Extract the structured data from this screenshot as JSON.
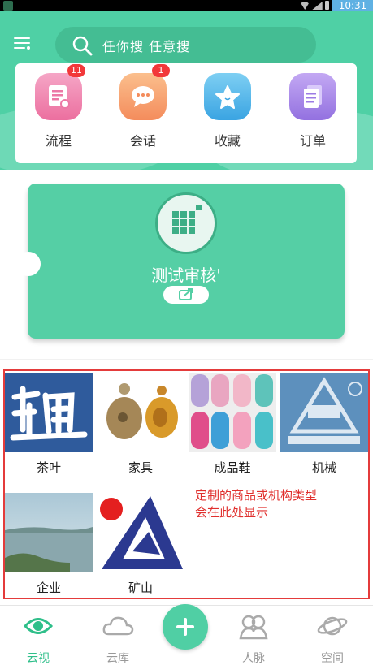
{
  "status_bar": {
    "time": "10:31"
  },
  "search": {
    "placeholder": "任你搜  任意搜"
  },
  "quick_actions": [
    {
      "label": "流程",
      "badge": "11",
      "icon": "document-icon",
      "color": "#f08bb2"
    },
    {
      "label": "会话",
      "badge": "1",
      "icon": "chat-icon",
      "color": "#f7a577"
    },
    {
      "label": "收藏",
      "badge": "",
      "icon": "star-icon",
      "color": "#4ab8ea"
    },
    {
      "label": "订单",
      "badge": "",
      "icon": "order-list-icon",
      "color": "#a68be8"
    }
  ],
  "feature_card": {
    "title": "测试审核'",
    "icon": "grid-apps-icon"
  },
  "categories": [
    {
      "label": "茶叶"
    },
    {
      "label": "家具"
    },
    {
      "label": "成品鞋"
    },
    {
      "label": "机械"
    },
    {
      "label": "企业"
    },
    {
      "label": "矿山"
    }
  ],
  "note": {
    "line1": "定制的商品或机构类型",
    "line2": "会在此处显示"
  },
  "tabs": [
    {
      "label": "云视",
      "icon": "eye-icon",
      "active": true
    },
    {
      "label": "云库",
      "icon": "cloud-icon",
      "active": false
    },
    {
      "label": "人脉",
      "icon": "contacts-icon",
      "active": false
    },
    {
      "label": "空间",
      "icon": "planet-icon",
      "active": false
    }
  ],
  "colors": {
    "brand": "#4fd0a5",
    "badge": "#f2383a",
    "note": "#e0302e",
    "active_tab": "#2fbf8a"
  }
}
